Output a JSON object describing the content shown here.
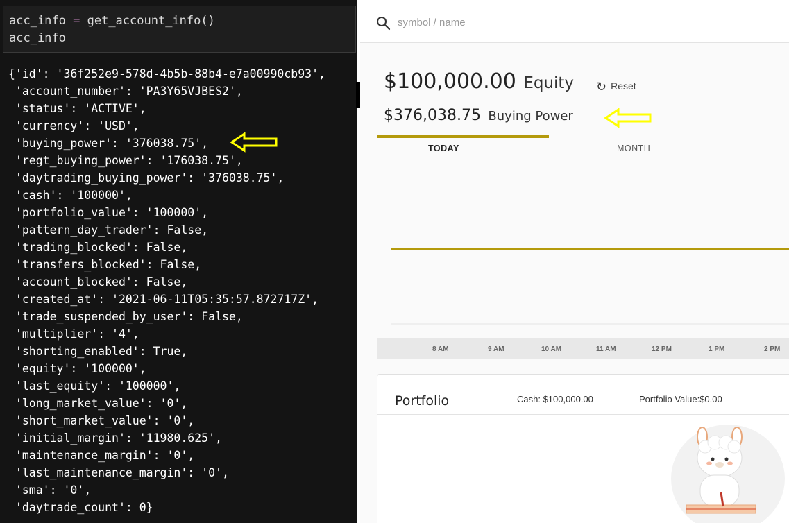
{
  "notebook": {
    "input_lines": [
      {
        "lhs": "acc_info ",
        "op": "=",
        "rhs": " get_account_info()"
      },
      {
        "lhs": "acc_info",
        "op": "",
        "rhs": ""
      }
    ],
    "output_lines": [
      "{'id': '36f252e9-578d-4b5b-88b4-e7a00990cb93',",
      " 'account_number': 'PA3Y65VJBES2',",
      " 'status': 'ACTIVE',",
      " 'currency': 'USD',",
      " 'buying_power': '376038.75',",
      " 'regt_buying_power': '176038.75',",
      " 'daytrading_buying_power': '376038.75',",
      " 'cash': '100000',",
      " 'portfolio_value': '100000',",
      " 'pattern_day_trader': False,",
      " 'trading_blocked': False,",
      " 'transfers_blocked': False,",
      " 'account_blocked': False,",
      " 'created_at': '2021-06-11T05:35:57.872717Z',",
      " 'trade_suspended_by_user': False,",
      " 'multiplier': '4',",
      " 'shorting_enabled': True,",
      " 'equity': '100000',",
      " 'last_equity': '100000',",
      " 'long_market_value': '0',",
      " 'short_market_value': '0',",
      " 'initial_margin': '11980.625',",
      " 'maintenance_margin': '0',",
      " 'last_maintenance_margin': '0',",
      " 'sma': '0',",
      " 'daytrade_count': 0}"
    ]
  },
  "dashboard": {
    "search": {
      "placeholder": "symbol / name"
    },
    "equity": {
      "value": "$100,000.00",
      "label": "Equity"
    },
    "reset_label": "Reset",
    "buying_power": {
      "value": "$376,038.75",
      "label": "Buying Power"
    },
    "tabs": {
      "today": "TODAY",
      "month": "MONTH"
    },
    "time_ticks": [
      "8 AM",
      "9 AM",
      "10 AM",
      "11 AM",
      "12 PM",
      "1 PM",
      "2 PM"
    ],
    "portfolio": {
      "title": "Portfolio",
      "cash": "Cash: $100,000.00",
      "value": "Portfolio Value:$0.00"
    }
  },
  "colors": {
    "accent_gold": "#b49a0c",
    "annotation_yellow": "#ffff00",
    "notebook_bg": "#141414"
  }
}
